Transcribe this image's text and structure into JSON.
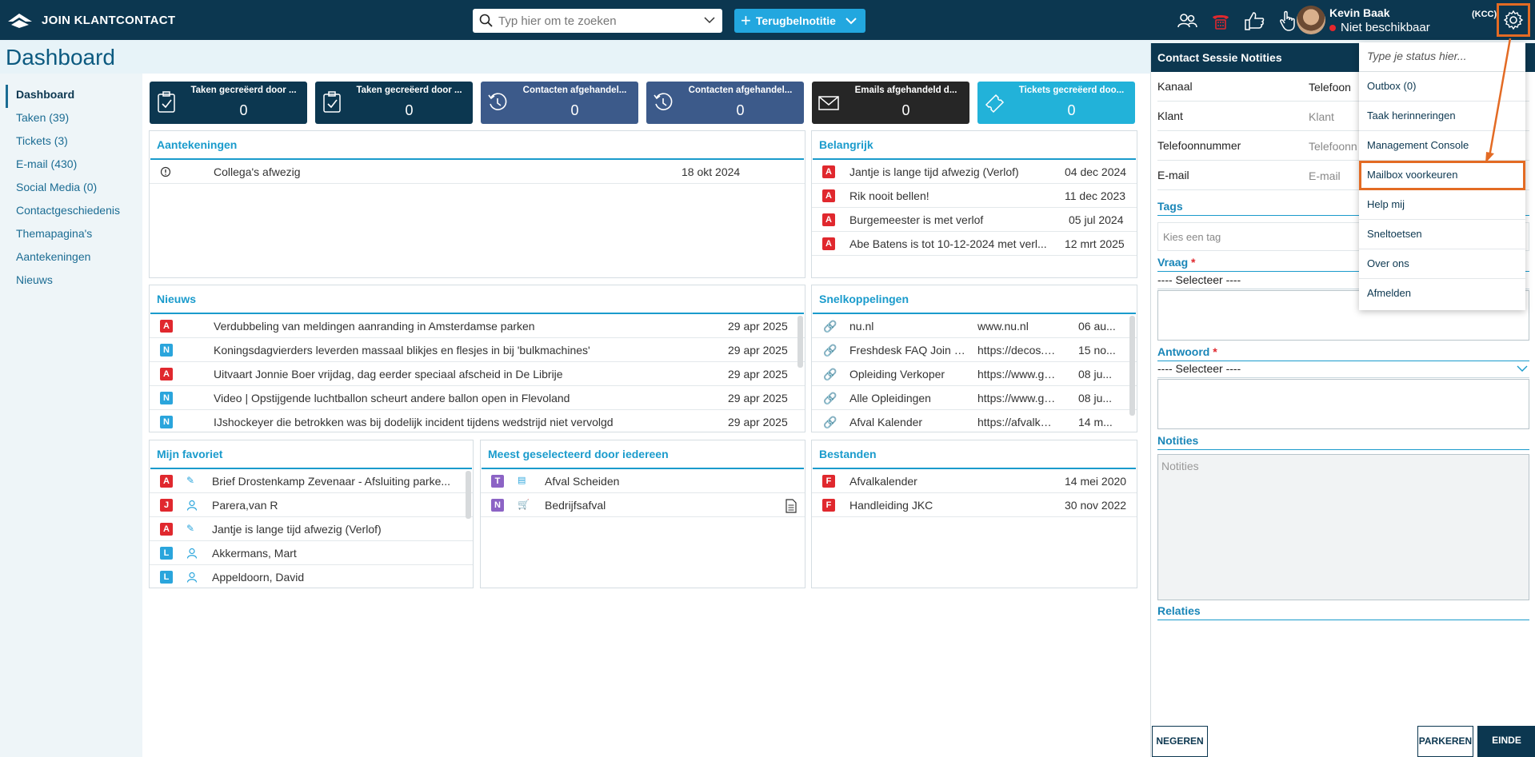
{
  "app": {
    "brand": "JOIN KLANTCONTACT",
    "search_placeholder": "Typ hier om te zoeken",
    "terug_label": "Terugbelnotitie",
    "user_name": "Kevin Baak",
    "user_status": "Niet beschikbaar",
    "user_group": "(KCC)",
    "colors": {
      "navy": "#0c3750",
      "accent": "#22a7df",
      "highlight": "#e36b24"
    }
  },
  "page": {
    "title": "Dashboard"
  },
  "sidebar": {
    "items": [
      {
        "label": "Dashboard",
        "active": true
      },
      {
        "label": "Taken (39)"
      },
      {
        "label": "Tickets (3)"
      },
      {
        "label": "E-mail (430)"
      },
      {
        "label": "Social Media (0)"
      },
      {
        "label": "Contactgeschiedenis"
      },
      {
        "label": "Themapagina's"
      },
      {
        "label": "Aantekeningen"
      },
      {
        "label": "Nieuws"
      }
    ]
  },
  "stats": [
    {
      "label": "Taken gecreëerd door ...",
      "value": "0",
      "icon": "clipboard-check-icon",
      "color": "#0c3750"
    },
    {
      "label": "Taken gecreëerd door ...",
      "value": "0",
      "icon": "clipboard-check-icon",
      "color": "#0c3750"
    },
    {
      "label": "Contacten afgehandel...",
      "value": "0",
      "icon": "history-icon",
      "color": "#3c5a8a"
    },
    {
      "label": "Contacten afgehandel...",
      "value": "0",
      "icon": "history-icon",
      "color": "#3c5a8a"
    },
    {
      "label": "Emails afgehandeld d...",
      "value": "0",
      "icon": "envelope-icon",
      "color": "#262626"
    },
    {
      "label": "Tickets gecreëerd doo...",
      "value": "0",
      "icon": "ticket-icon",
      "color": "#22b2d9"
    }
  ],
  "aantekeningen": {
    "title": "Aantekeningen",
    "rows": [
      {
        "text": "Collega's afwezig",
        "date": "18 okt 2024"
      }
    ]
  },
  "belangrijk": {
    "title": "Belangrijk",
    "rows": [
      {
        "badge": "A",
        "text": "Jantje is lange tijd afwezig (Verlof)",
        "date": "04 dec 2024"
      },
      {
        "badge": "A",
        "text": "Rik nooit bellen!",
        "date": "11 dec 2023"
      },
      {
        "badge": "A",
        "text": "Burgemeester is met verlof",
        "date": "05 jul 2024"
      },
      {
        "badge": "A",
        "text": "Abe Batens is tot 10-12-2024 met verl...",
        "date": "12 mrt 2025"
      }
    ]
  },
  "nieuws": {
    "title": "Nieuws",
    "rows": [
      {
        "badge": "A",
        "text": "Verdubbeling van meldingen aanranding in Amsterdamse parken",
        "date": "29 apr 2025"
      },
      {
        "badge": "N",
        "text": "Koningsdagvierders leverden massaal blikjes en flesjes in bij 'bulkmachines'",
        "date": "29 apr 2025"
      },
      {
        "badge": "A",
        "text": "Uitvaart Jonnie Boer vrijdag, dag eerder speciaal afscheid in De Librije",
        "date": "29 apr 2025"
      },
      {
        "badge": "N",
        "text": "Video | Opstijgende luchtballon scheurt andere ballon open in Flevoland",
        "date": "29 apr 2025"
      },
      {
        "badge": "N",
        "text": "IJshockeyer die betrokken was bij dodelijk incident tijdens wedstrijd niet vervolgd",
        "date": "29 apr 2025"
      }
    ]
  },
  "snelkoppelingen": {
    "title": "Snelkoppelingen",
    "rows": [
      {
        "name": "nu.nl",
        "url": "www.nu.nl",
        "date": "06 au..."
      },
      {
        "name": "Freshdesk FAQ Join K...",
        "url": "https://decos.fr...",
        "date": "15 no..."
      },
      {
        "name": "Opleiding Verkoper",
        "url": "https://www.gil...",
        "date": "08 ju..."
      },
      {
        "name": "Alle Opleidingen",
        "url": "https://www.gil...",
        "date": "08 ju..."
      },
      {
        "name": "Afval Kalender",
        "url": "https://afvalkal...",
        "date": "14 m..."
      }
    ]
  },
  "favoriet": {
    "title": "Mijn favoriet",
    "rows": [
      {
        "badge": "A",
        "icon": "edit-icon",
        "text": "Brief Drostenkamp Zevenaar - Afsluiting parke..."
      },
      {
        "badge": "J",
        "icon": "person-icon",
        "text": "Parera,van R"
      },
      {
        "badge": "A",
        "icon": "edit-icon",
        "text": "Jantje is lange tijd afwezig (Verlof)"
      },
      {
        "badge": "L",
        "icon": "person-icon",
        "text": "Akkermans, Mart"
      },
      {
        "badge": "L",
        "icon": "person-icon",
        "text": "Appeldoorn, David"
      }
    ]
  },
  "meest": {
    "title": "Meest geselecteerd door iedereen",
    "rows": [
      {
        "badge": "T",
        "icon": "list-icon",
        "text": "Afval Scheiden"
      },
      {
        "badge": "N",
        "icon": "cart-icon",
        "text": "Bedrijfsafval"
      }
    ]
  },
  "bestanden": {
    "title": "Bestanden",
    "rows": [
      {
        "badge": "F",
        "text": "Afvalkalender",
        "date": "14 mei 2020"
      },
      {
        "badge": "F",
        "text": "Handleiding JKC",
        "date": "30 nov 2022"
      }
    ]
  },
  "session": {
    "title": "Contact Sessie Notities",
    "rows": [
      {
        "key": "Kanaal",
        "value": "Telefoon"
      },
      {
        "key": "Klant",
        "value": "Klant"
      },
      {
        "key": "Telefoonnummer",
        "value": "Telefoonn"
      },
      {
        "key": "E-mail",
        "value": "E-mail"
      }
    ],
    "tags_label": "Tags",
    "tags_placeholder": "Kies een tag",
    "vraag_label": "Vraag",
    "vraag_select": "---- Selecteer ----",
    "antwoord_label": "Antwoord",
    "antwoord_select": "---- Selecteer ----",
    "notities_label": "Notities",
    "notities_placeholder": "Notities",
    "relaties_label": "Relaties",
    "btn_negeren": "NEGEREN",
    "btn_parkeren": "PARKEREN",
    "btn_einde": "EINDE",
    "required_mark": "*"
  },
  "menu": {
    "status_placeholder": "Type je status hier...",
    "items": [
      {
        "label": "Outbox (0)"
      },
      {
        "label": "Taak herinneringen"
      },
      {
        "label": "Management Console"
      },
      {
        "label": "Mailbox voorkeuren",
        "highlighted": true
      },
      {
        "label": "Help mij"
      },
      {
        "label": "Sneltoetsen"
      },
      {
        "label": "Over ons"
      },
      {
        "label": "Afmelden"
      }
    ]
  }
}
